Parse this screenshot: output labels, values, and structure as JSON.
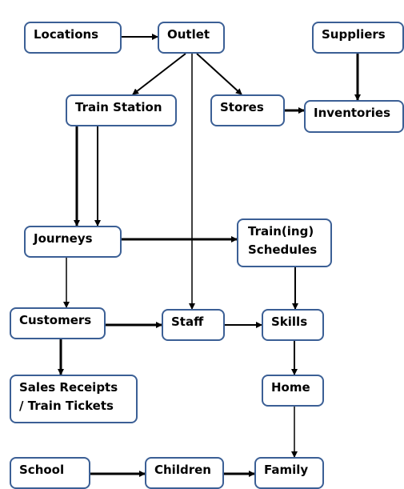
{
  "nodes": {
    "locations": "Locations",
    "outlet": "Outlet",
    "suppliers": "Suppliers",
    "train_station": "Train Station",
    "stores": "Stores",
    "inventories": "Inventories",
    "journeys": "Journeys",
    "training_schedules_1": "Train(ing)",
    "training_schedules_2": "Schedules",
    "customers": "Customers",
    "staff": "Staff",
    "skills": "Skills",
    "sales_receipts_1": "Sales Receipts",
    "sales_receipts_2": "/ Train Tickets",
    "home": "Home",
    "school": "School",
    "children": "Children",
    "family": "Family"
  },
  "edges": [
    {
      "from": "locations",
      "to": "outlet"
    },
    {
      "from": "outlet",
      "to": "train_station"
    },
    {
      "from": "outlet",
      "to": "stores"
    },
    {
      "from": "outlet",
      "to": "staff"
    },
    {
      "from": "suppliers",
      "to": "inventories"
    },
    {
      "from": "stores",
      "to": "inventories"
    },
    {
      "from": "train_station",
      "to": "journeys"
    },
    {
      "from": "train_station",
      "to": "journeys"
    },
    {
      "from": "journeys",
      "to": "training_schedules"
    },
    {
      "from": "journeys",
      "to": "customers"
    },
    {
      "from": "training_schedules",
      "to": "skills"
    },
    {
      "from": "customers",
      "to": "staff"
    },
    {
      "from": "customers",
      "to": "sales_receipts"
    },
    {
      "from": "staff",
      "to": "skills"
    },
    {
      "from": "skills",
      "to": "home"
    },
    {
      "from": "home",
      "to": "family"
    },
    {
      "from": "school",
      "to": "children"
    },
    {
      "from": "children",
      "to": "family"
    }
  ]
}
